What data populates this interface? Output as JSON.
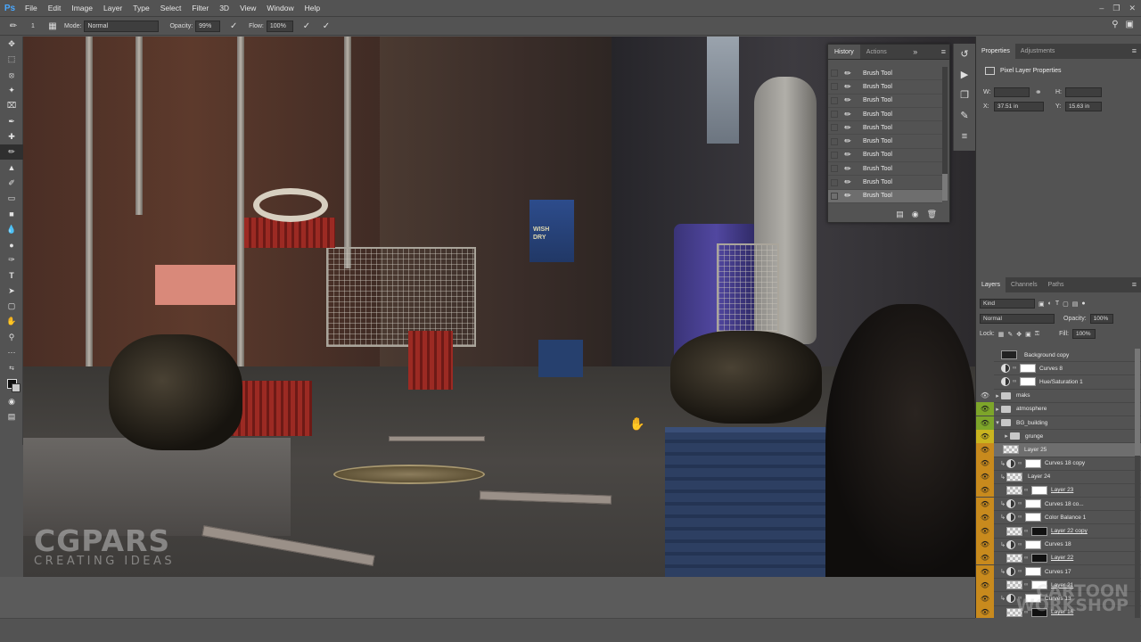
{
  "app": {
    "logo": "Ps"
  },
  "menu": [
    "File",
    "Edit",
    "Image",
    "Layer",
    "Type",
    "Select",
    "Filter",
    "3D",
    "View",
    "Window",
    "Help"
  ],
  "options_bar": {
    "brush_size": "1",
    "mode_label": "Mode:",
    "mode_value": "Normal",
    "opacity_label": "Opacity:",
    "opacity_value": "99%",
    "flow_label": "Flow:",
    "flow_value": "100%"
  },
  "history_panel": {
    "tabs": [
      "History",
      "Actions"
    ],
    "items": [
      "Brush Tool",
      "Brush Tool",
      "Brush Tool",
      "Brush Tool",
      "Brush Tool",
      "Brush Tool",
      "Brush Tool",
      "Brush Tool",
      "Brush Tool",
      "Brush Tool"
    ]
  },
  "canvas": {
    "awning_text_1": "WISH",
    "awning_text_2": "DRY",
    "watermark_big": "CGPARS",
    "watermark_small": "CREATING IDEAS"
  },
  "properties_panel": {
    "tabs": [
      "Properties",
      "Adjustments"
    ],
    "title": "Pixel Layer Properties",
    "w_label": "W:",
    "h_label": "H:",
    "x_label": "X:",
    "x_value": "37.51 in",
    "y_label": "Y:",
    "y_value": "15.63 in"
  },
  "layers_panel": {
    "tabs": [
      "Layers",
      "Channels",
      "Paths"
    ],
    "kind_value": "Kind",
    "blend_value": "Normal",
    "opacity_label": "Opacity:",
    "opacity_value": "100%",
    "lock_label": "Lock:",
    "fill_label": "Fill:",
    "fill_value": "100%",
    "layers": [
      {
        "name": "Background copy",
        "color": "gray",
        "type": "pixel-dark"
      },
      {
        "name": "Curves 8",
        "color": "gray",
        "type": "adjust"
      },
      {
        "name": "Hue/Saturation 1",
        "color": "gray",
        "type": "adjust"
      },
      {
        "name": "maks",
        "color": "gray",
        "type": "folder"
      },
      {
        "name": "atmosphere",
        "color": "green",
        "type": "folder"
      },
      {
        "name": "BG_building",
        "color": "green",
        "type": "folder-open"
      },
      {
        "name": "grunge",
        "color": "yellow",
        "type": "folder-sub"
      },
      {
        "name": "Layer 25",
        "color": "orange",
        "type": "pixel",
        "selected": true
      },
      {
        "name": "Curves 18 copy",
        "color": "orange",
        "type": "adjust-clip"
      },
      {
        "name": "Layer 24",
        "color": "orange",
        "type": "pixel-clip"
      },
      {
        "name": "Layer 23",
        "color": "orange",
        "type": "pixel-mask",
        "underline": true
      },
      {
        "name": "Curves 18 co...",
        "color": "orange",
        "type": "adjust-clip"
      },
      {
        "name": "Color Balance 1",
        "color": "orange",
        "type": "adjust-clip"
      },
      {
        "name": "Layer 22 copy",
        "color": "orange",
        "type": "pixel-mask-black",
        "underline": true
      },
      {
        "name": "Curves 18",
        "color": "orange",
        "type": "adjust-clip"
      },
      {
        "name": "Layer 22",
        "color": "orange",
        "type": "pixel-mask-black",
        "underline": true
      },
      {
        "name": "Curves 17",
        "color": "orange",
        "type": "adjust-clip"
      },
      {
        "name": "Layer 21",
        "color": "orange",
        "type": "pixel-mask",
        "underline": true
      },
      {
        "name": "Curves 13",
        "color": "orange",
        "type": "adjust-clip"
      },
      {
        "name": "Layer 16",
        "color": "orange",
        "type": "pixel-mask-black",
        "underline": true
      }
    ]
  },
  "watermark_right": {
    "line1": "CARTOON",
    "line2": "WORKSHOP"
  }
}
